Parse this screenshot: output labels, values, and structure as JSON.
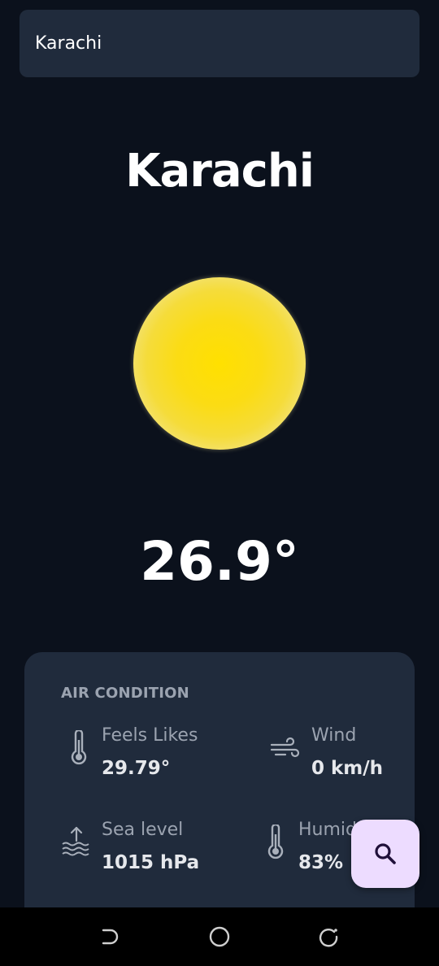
{
  "search": {
    "value": "Karachi",
    "placeholder": ""
  },
  "weather": {
    "city": "Karachi",
    "temperature": "26.9°",
    "condition_icon": "sun-icon"
  },
  "air_condition": {
    "title": "AIR CONDITION",
    "items": [
      {
        "label": "Feels Likes",
        "value": "29.79°",
        "icon": "thermometer-icon"
      },
      {
        "label": "Wind",
        "value": "0 km/h",
        "icon": "wind-icon"
      },
      {
        "label": "Sea level",
        "value": "1015 hPa",
        "icon": "sea-level-icon"
      },
      {
        "label": "Humid",
        "value": "83%",
        "icon": "thermometer-icon"
      }
    ]
  },
  "fab": {
    "icon": "search-icon"
  },
  "navbar": {
    "items": [
      {
        "icon": "back-icon"
      },
      {
        "icon": "home-icon"
      },
      {
        "icon": "recent-apps-icon"
      }
    ]
  },
  "colors": {
    "background": "#0b111c",
    "card": "#202b3c",
    "accent": "#eddcff",
    "sun": "#ffe000",
    "label_text": "#9ba3b0"
  }
}
